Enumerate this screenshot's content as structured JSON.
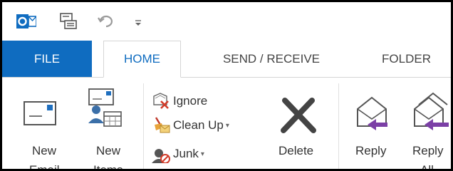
{
  "quick_access": {
    "app_icon": "outlook-logo-icon",
    "send_receive_icon": "send-receive-all-icon",
    "undo_icon": "undo-icon",
    "customize_icon": "customize-qat-icon"
  },
  "tabs": [
    {
      "label": "FILE"
    },
    {
      "label": "HOME"
    },
    {
      "label": "SEND / RECEIVE"
    },
    {
      "label": "FOLDER"
    }
  ],
  "ribbon": {
    "new_email_label": "New",
    "new_email_label2": "Email",
    "new_items_label": "New",
    "new_items_label2": "Items",
    "ignore_label": "Ignore",
    "cleanup_label": "Clean Up",
    "junk_label": "Junk",
    "delete_label": "Delete",
    "reply_label": "Reply",
    "reply_all_label": "Reply",
    "reply_all_label2": "All"
  },
  "colors": {
    "file_tab": "#0f6cc0",
    "accent_purple": "#7b3fa6"
  }
}
